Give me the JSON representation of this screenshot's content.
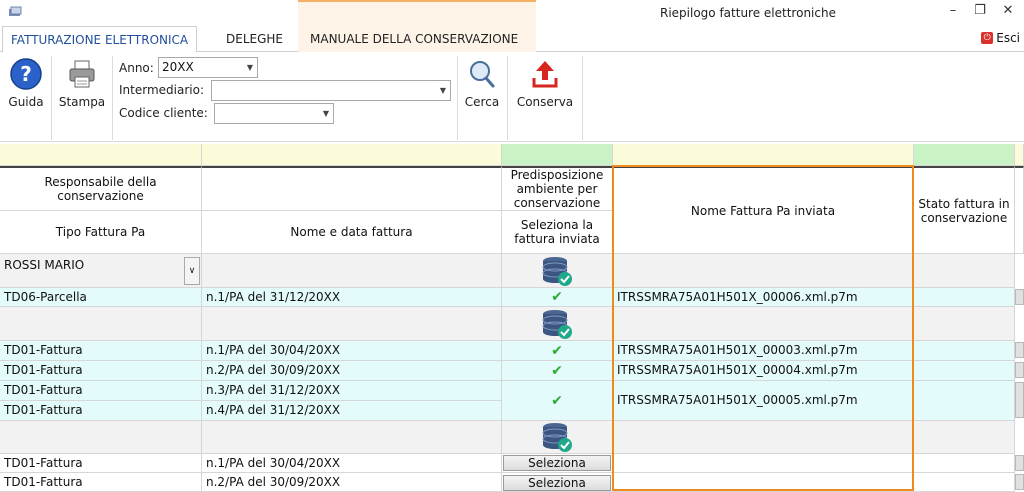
{
  "window": {
    "title": "Riepilogo fatture elettroniche"
  },
  "tabs": [
    {
      "label": "FATTURAZIONE ELETTRONICA"
    },
    {
      "label": "DELEGHE"
    },
    {
      "label": "MANUALE DELLA CONSERVAZIONE"
    }
  ],
  "esci_label": "Esci",
  "ribbon": {
    "guida": "Guida",
    "stampa": "Stampa",
    "cerca": "Cerca",
    "conserva": "Conserva",
    "anno_label": "Anno:",
    "anno_value": "20XX",
    "intermediario_label": "Intermediario:",
    "intermediario_value": "",
    "codice_label": "Codice cliente:",
    "codice_value": ""
  },
  "headers": {
    "responsabile": "Responsabile della conservazione",
    "tipo": "Tipo Fattura Pa",
    "nome_data": "Nome e data fattura",
    "predisposizione": "Predisposizione ambiente per conservazione",
    "seleziona": "Seleziona la fattura inviata",
    "nome_inviata": "Nome Fattura Pa inviata",
    "stato": "Stato fattura in conservazione"
  },
  "responsabile_value": "ROSSI MARIO",
  "rows": [
    {
      "tipo": "TD06-Parcella",
      "nome": "n.1/PA del 31/12/20XX",
      "file": "ITRSSMRA75A01H501X_00006.xml.p7m"
    },
    {
      "tipo": "TD01-Fattura",
      "nome": "n.1/PA del 30/04/20XX",
      "file": "ITRSSMRA75A01H501X_00003.xml.p7m"
    },
    {
      "tipo": "TD01-Fattura",
      "nome": "n.2/PA del 30/09/20XX",
      "file": "ITRSSMRA75A01H501X_00004.xml.p7m"
    },
    {
      "tipo": "TD01-Fattura",
      "nome": "n.3/PA del 31/12/20XX",
      "file": "ITRSSMRA75A01H501X_00005.xml.p7m"
    },
    {
      "tipo": "TD01-Fattura",
      "nome": "n.4/PA del 31/12/20XX",
      "file": ""
    },
    {
      "tipo": "TD01-Fattura",
      "nome": "n.1/PA del 30/04/20XX",
      "file": ""
    },
    {
      "tipo": "TD01-Fattura",
      "nome": "n.2/PA del 30/09/20XX",
      "file": ""
    }
  ],
  "seleziona_btn": "Seleziona",
  "colors": {
    "accent": "#f08a1c",
    "check": "#2faa32",
    "tabActive": "#1f4f9a"
  }
}
